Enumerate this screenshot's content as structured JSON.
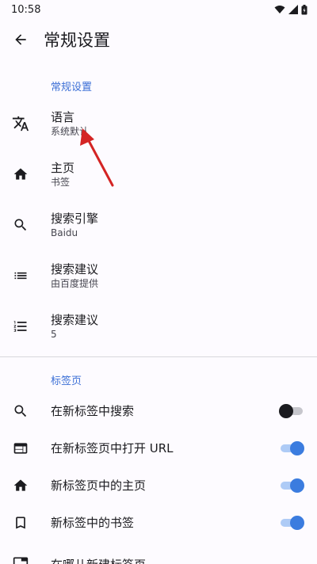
{
  "status_bar": {
    "time": "10:58"
  },
  "app_bar": {
    "title": "常规设置"
  },
  "sections": {
    "general": {
      "header": "常规设置"
    },
    "tabs": {
      "header": "标签页"
    }
  },
  "prefs": [
    {
      "title": "语言",
      "summary": "系统默认",
      "icon": "translate-icon"
    },
    {
      "title": "主页",
      "summary": "书签",
      "icon": "home-icon"
    },
    {
      "title": "搜索引擎",
      "summary": "Baidu",
      "icon": "search-icon"
    },
    {
      "title": "搜索建议",
      "summary": "由百度提供",
      "icon": "list-icon"
    },
    {
      "title": "搜索建议",
      "summary": "5",
      "icon": "numbered-list-icon"
    }
  ],
  "tab_prefs": [
    {
      "title": "在新标签中搜索",
      "enabled": false,
      "icon": "search-icon"
    },
    {
      "title": "在新标签页中打开 URL",
      "enabled": true,
      "icon": "web-window-icon"
    },
    {
      "title": "新标签页中的主页",
      "enabled": true,
      "icon": "home-icon"
    },
    {
      "title": "新标签中的书签",
      "enabled": true,
      "icon": "bookmark-icon"
    },
    {
      "title": "在哪儿新建标签页",
      "icon": "tab-icon"
    }
  ],
  "colors": {
    "accent": "#3b7cdf",
    "section_header": "#3b6fd6",
    "annotation": "#d42424"
  }
}
